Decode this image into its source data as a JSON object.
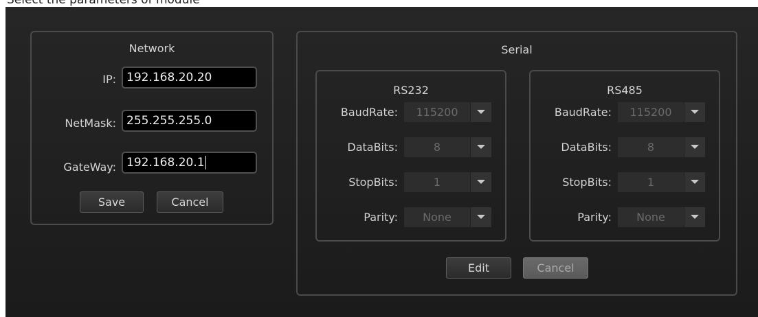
{
  "network": {
    "title": "Network",
    "ip_label": "IP:",
    "ip_value": "192.168.20.20",
    "netmask_label": "NetMask:",
    "netmask_value": "255.255.255.0",
    "gateway_label": "GateWay:",
    "gateway_value": "192.168.20.1",
    "save_label": "Save",
    "cancel_label": "Cancel"
  },
  "serial": {
    "title": "Serial",
    "rs232": {
      "title": "RS232",
      "baudrate_label": "BaudRate:",
      "baudrate_value": "115200",
      "databits_label": "DataBits:",
      "databits_value": "8",
      "stopbits_label": "StopBits:",
      "stopbits_value": "1",
      "parity_label": "Parity:",
      "parity_value": "None"
    },
    "rs485": {
      "title": "RS485",
      "baudrate_label": "BaudRate:",
      "baudrate_value": "115200",
      "databits_label": "DataBits:",
      "databits_value": "8",
      "stopbits_label": "StopBits:",
      "stopbits_value": "1",
      "parity_label": "Parity:",
      "parity_value": "None"
    },
    "edit_label": "Edit",
    "cancel_label": "Cancel"
  },
  "icons": {
    "dropdown": "chevron-down-icon"
  },
  "colors": {
    "panel_bg": "#222222",
    "field_bg": "#000000",
    "text": "#d4d4d4",
    "disabled_text": "#6a6a6a"
  }
}
